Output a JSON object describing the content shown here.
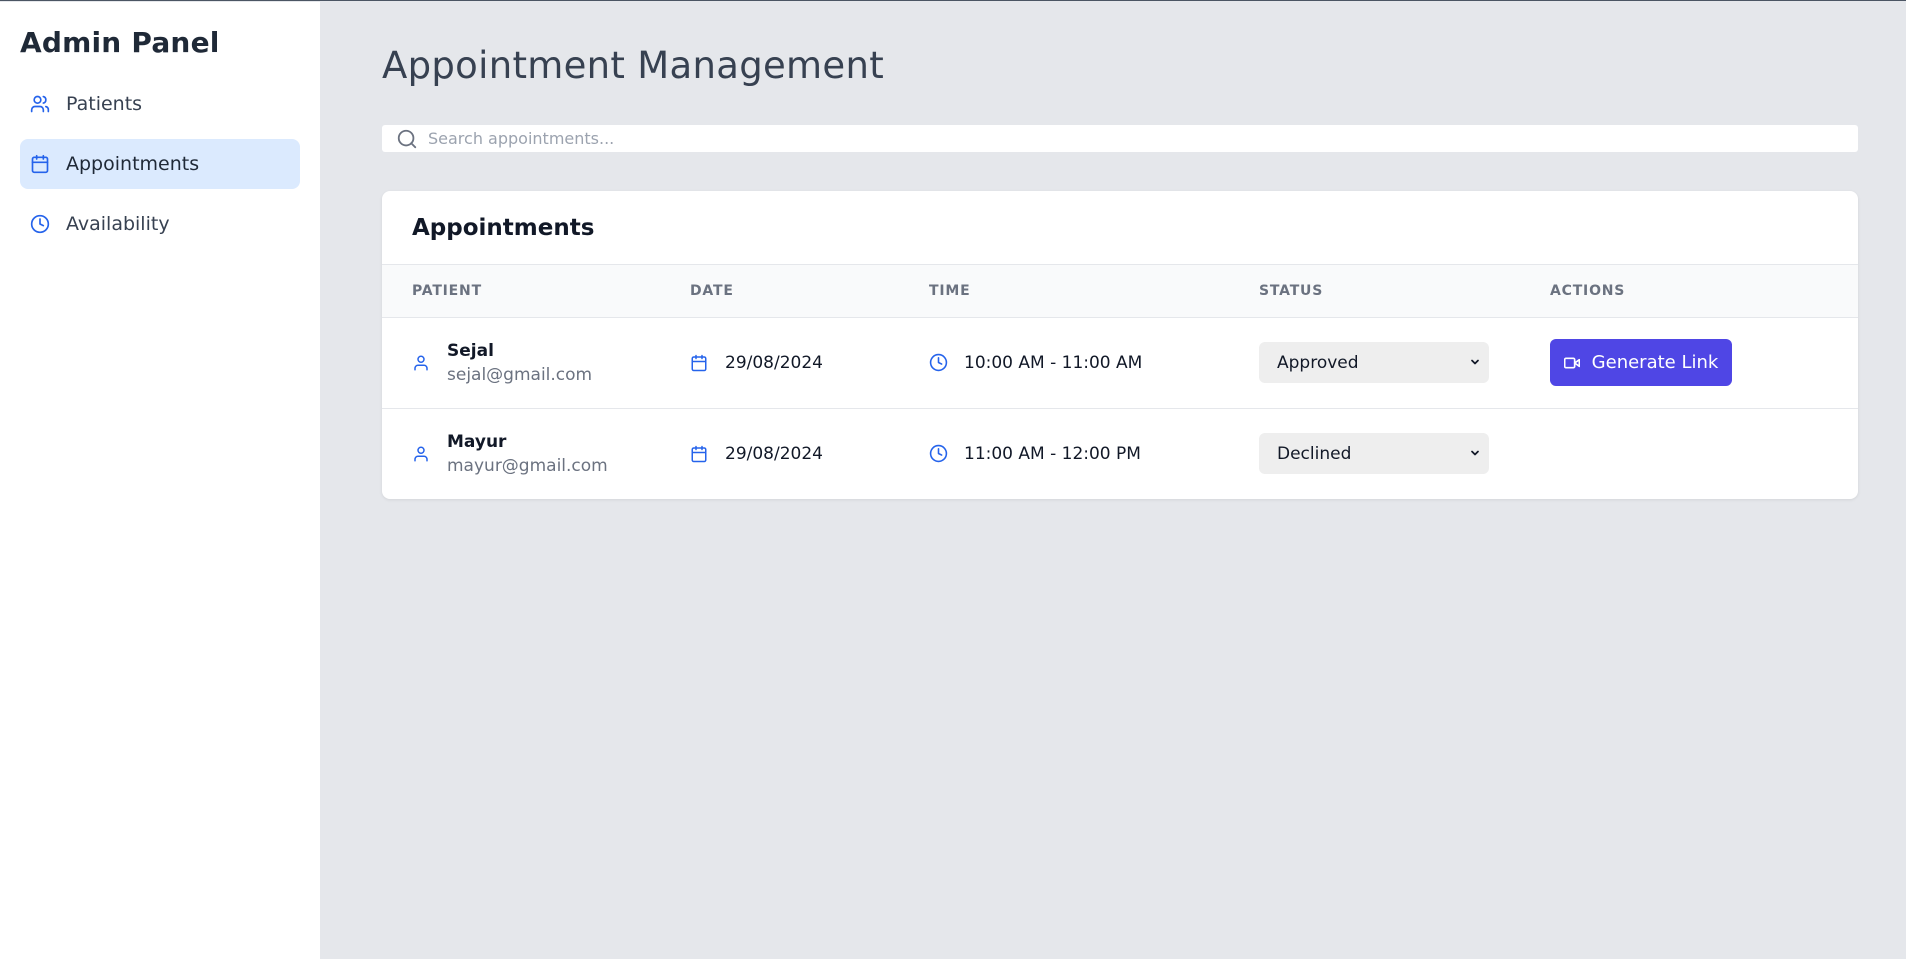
{
  "sidebar": {
    "title": "Admin Panel",
    "items": [
      {
        "label": "Patients",
        "icon": "users-icon"
      },
      {
        "label": "Appointments",
        "icon": "calendar-icon",
        "active": true
      },
      {
        "label": "Availability",
        "icon": "clock-icon"
      }
    ]
  },
  "main": {
    "title": "Appointment Management",
    "search": {
      "placeholder": "Search appointments...",
      "value": ""
    },
    "card": {
      "title": "Appointments",
      "columns": [
        "PATIENT",
        "DATE",
        "TIME",
        "STATUS",
        "ACTIONS"
      ],
      "rows": [
        {
          "name": "Sejal",
          "email": "sejal@gmail.com",
          "date": "29/08/2024",
          "time": "10:00 AM - 11:00 AM",
          "status": "Approved",
          "action": "Generate Link"
        },
        {
          "name": "Mayur",
          "email": "mayur@gmail.com",
          "date": "29/08/2024",
          "time": "11:00 AM - 12:00 PM",
          "status": "Declined",
          "action": ""
        }
      ]
    }
  },
  "colors": {
    "accent": "#2563eb",
    "active_bg": "#dbeafe",
    "button": "#4f46e5"
  }
}
